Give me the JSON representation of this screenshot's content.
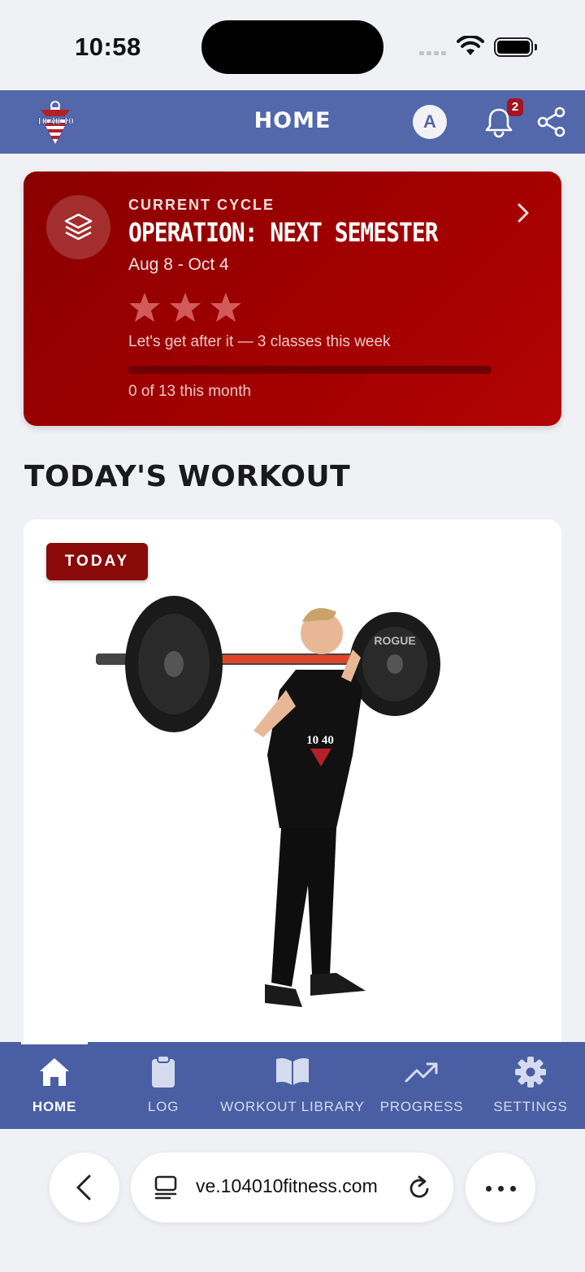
{
  "status_bar": {
    "time": "10:58"
  },
  "header": {
    "title": "HOME",
    "avatar_initial": "A",
    "notification_count": "2",
    "logo_text": "10 40 10"
  },
  "cycle": {
    "eyebrow": "CURRENT CYCLE",
    "name": "OPERATION: NEXT SEMESTER",
    "dates": "Aug 8 - Oct 4",
    "stars_total": 3,
    "stars_filled": 0,
    "motto": "Let's get after it — 3 classes this week",
    "progress_value": 0,
    "progress_max": 13,
    "count_text": "0 of 13 this month"
  },
  "workout": {
    "section_title": "TODAY'S WORKOUT",
    "badge": "TODAY",
    "shirt_text": "10 40",
    "plate_text": "ROGUE"
  },
  "nav": {
    "items": [
      {
        "label": "HOME",
        "icon": "home-icon",
        "active": true
      },
      {
        "label": "LOG",
        "icon": "clipboard-icon",
        "active": false
      },
      {
        "label": "WORKOUT LIBRARY",
        "icon": "book-icon",
        "active": false
      },
      {
        "label": "PROGRESS",
        "icon": "trending-up-icon",
        "active": false
      },
      {
        "label": "SETTINGS",
        "icon": "gear-icon",
        "active": false
      }
    ]
  },
  "browser": {
    "url": "ve.104010fitness.com"
  },
  "colors": {
    "header": "#5367ab",
    "nav": "#4a5fa3",
    "accent_red": "#a30000",
    "badge_red": "#8a0a0a"
  }
}
